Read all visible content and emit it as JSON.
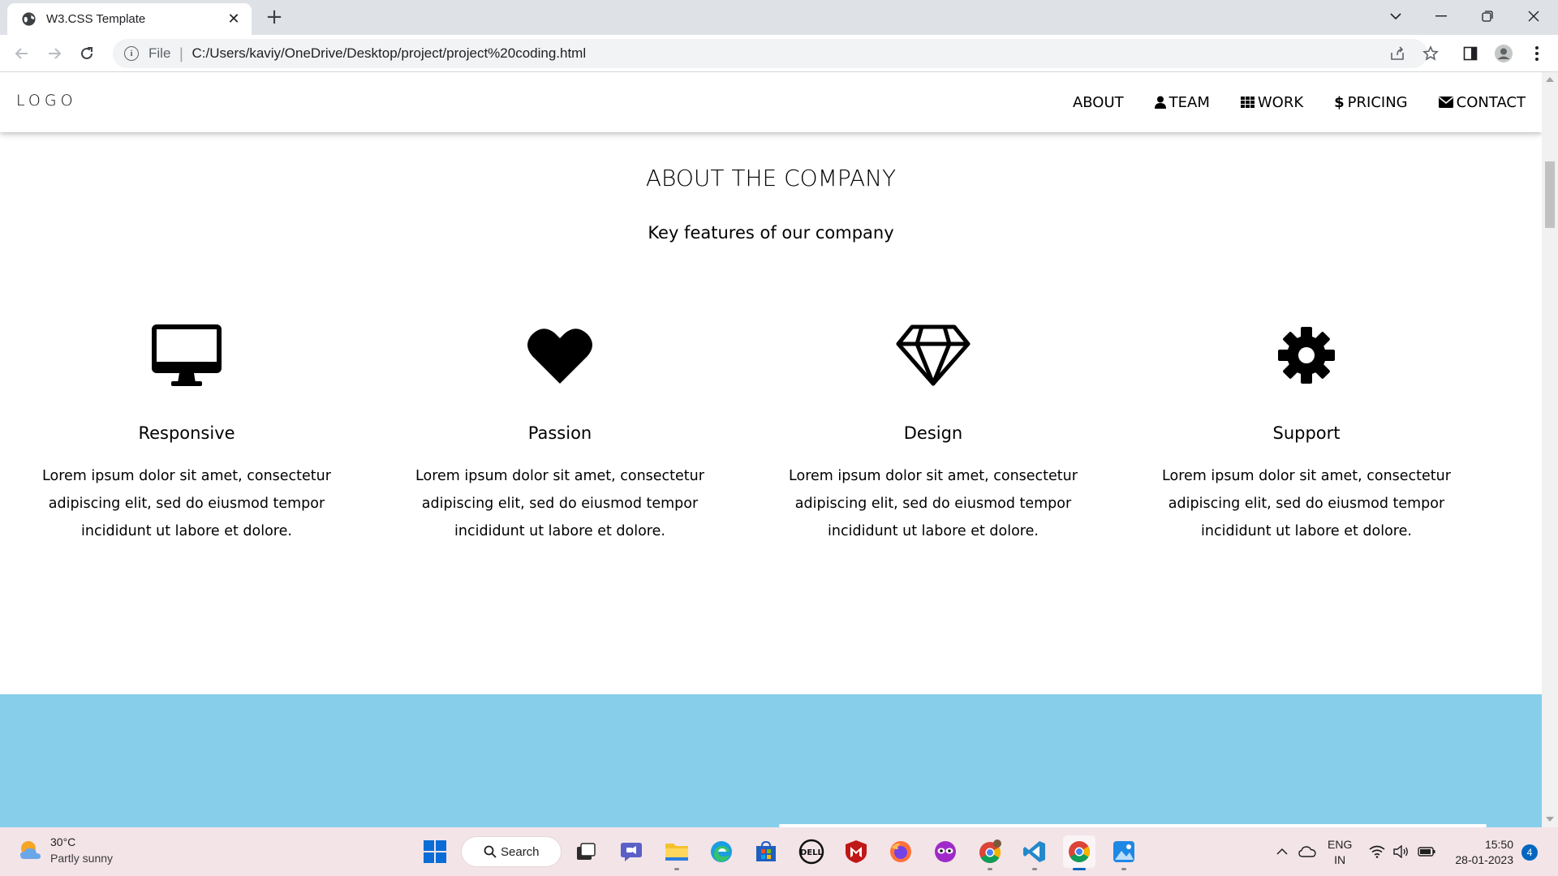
{
  "browser": {
    "tab_title": "W3.CSS Template",
    "url_scheme": "File",
    "url": "C:/Users/kaviy/OneDrive/Desktop/project/project%20coding.html"
  },
  "site": {
    "logo": "LOGO",
    "nav": [
      {
        "label": "ABOUT",
        "icon": ""
      },
      {
        "label": "TEAM",
        "icon": "user-icon"
      },
      {
        "label": "WORK",
        "icon": "th-grid-icon"
      },
      {
        "label": "PRICING",
        "icon": "dollar-icon"
      },
      {
        "label": "CONTACT",
        "icon": "envelope-icon"
      }
    ],
    "about": {
      "title": "ABOUT THE COMPANY",
      "subtitle": "Key features of our company",
      "features": [
        {
          "icon": "desktop-icon",
          "name": "Responsive",
          "desc": "Lorem ipsum dolor sit amet, consectetur adipiscing elit, sed do eiusmod tempor incididunt ut labore et dolore."
        },
        {
          "icon": "heart-icon",
          "name": "Passion",
          "desc": "Lorem ipsum dolor sit amet, consectetur adipiscing elit, sed do eiusmod tempor incididunt ut labore et dolore."
        },
        {
          "icon": "diamond-icon",
          "name": "Design",
          "desc": "Lorem ipsum dolor sit amet, consectetur adipiscing elit, sed do eiusmod tempor incididunt ut labore et dolore."
        },
        {
          "icon": "cog-icon",
          "name": "Support",
          "desc": "Lorem ipsum dolor sit amet, consectetur adipiscing elit, sed do eiusmod tempor incididunt ut labore et dolore."
        }
      ]
    },
    "colors": {
      "section_blue": "#87ceeb"
    }
  },
  "taskbar": {
    "weather_temp": "30°C",
    "weather_cond": "Partly sunny",
    "search_label": "Search",
    "lang_top": "ENG",
    "lang_bottom": "IN",
    "time": "15:50",
    "date": "28-01-2023",
    "notification_count": "4"
  }
}
